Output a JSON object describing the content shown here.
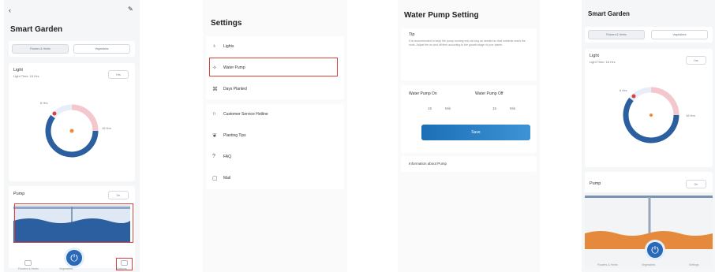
{
  "colors": {
    "accent": "#2a69b8",
    "highlight": "#d8423b",
    "soil": "#e58a3c",
    "water": "#2c5f9f"
  },
  "screen1": {
    "back_icon": "chevron-left-icon",
    "edit_icon": "pencil-icon",
    "title": "Smart Garden",
    "tabs": [
      "Flowers & Herbs",
      "Vegetables"
    ],
    "light_label": "Light",
    "light_sub": "Light Time: 16 Hrs",
    "light_button": "Hrs",
    "dial_left": "6 Hrs",
    "dial_right": "16 Hrs",
    "pump_label": "Pump",
    "pump_button": "On",
    "nav": [
      "Flowers & Herbs",
      "Vegetables",
      "Settings"
    ]
  },
  "screen2": {
    "title": "Settings",
    "items": [
      {
        "icon": "bulb-icon",
        "label": "Lights"
      },
      {
        "icon": "pump-icon",
        "label": "Water Pump"
      },
      {
        "icon": "plant-icon",
        "label": "Days Planted"
      },
      {
        "icon": "headset-icon",
        "label": "Customer Service Hotline"
      },
      {
        "icon": "leaf-icon",
        "label": "Planting Tips"
      },
      {
        "icon": "help-icon",
        "label": "FAQ"
      },
      {
        "icon": "mail-icon",
        "label": "Mail"
      }
    ]
  },
  "screen3": {
    "title": "Water Pump Setting",
    "tip_label": "Tip",
    "tip_text": "It is recommended to keep the pump running only as long as needed so that nutrients reach the roots. Adjust the on and off time according to the growth stage of your plants.",
    "on_label": "Water Pump On",
    "off_label": "Water Pump Off",
    "on_value": "15",
    "on_unit": "Min",
    "off_value": "15",
    "off_unit": "Min",
    "save_button": "Save",
    "info_link": "Information about Pump"
  },
  "screen4": {
    "title": "Smart Garden",
    "tabs": [
      "Flowers & Herbs",
      "Vegetables"
    ],
    "light_label": "Light",
    "light_sub": "Light Time: 16 Hrs",
    "light_button": "Hrs",
    "dial_left": "6 Hrs",
    "dial_right": "16 Hrs",
    "pump_label": "Pump",
    "pump_button": "On",
    "nav": [
      "Flowers & Herbs",
      "Vegetables",
      "Settings"
    ]
  }
}
